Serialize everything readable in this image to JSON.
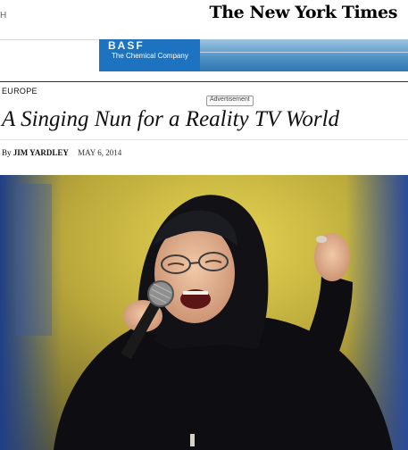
{
  "header": {
    "menu_glyph": "H",
    "logo": "The New York Times"
  },
  "ad": {
    "brand": "BASF",
    "tagline": "The Chemical Company"
  },
  "article": {
    "section": "EUROPE",
    "advertisement_label": "Advertisement",
    "headline": "A Singing Nun for a Reality TV World",
    "byline_prefix": "By",
    "author": "JIM YARDLEY",
    "date": "MAY 6, 2014"
  },
  "photo": {
    "subject": "singing nun with microphone"
  },
  "colors": {
    "ad_blue": "#1d73bf",
    "stage_yellow": "#c7b63a",
    "habit_black": "#0d0d12"
  }
}
